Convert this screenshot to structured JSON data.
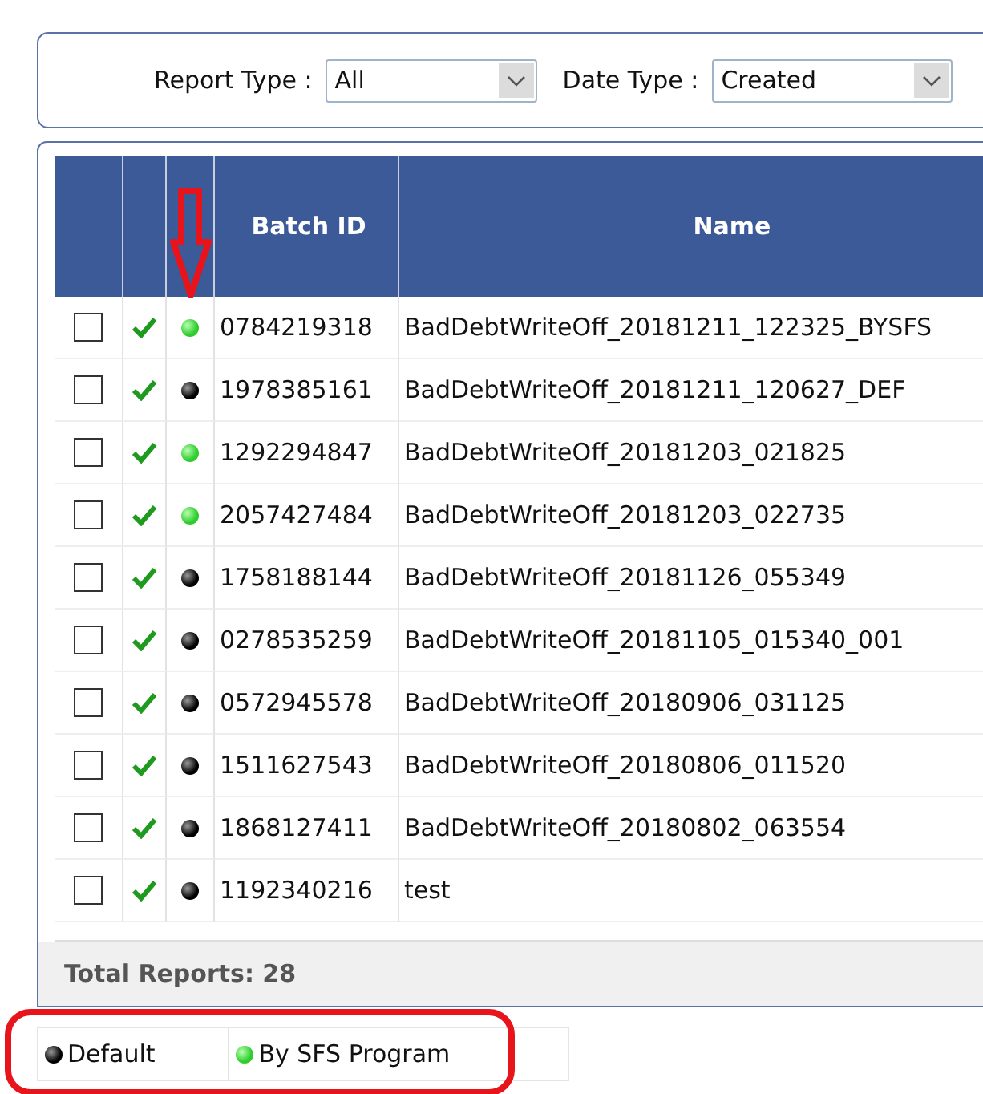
{
  "filters": [
    {
      "label": "Report Type :",
      "value": "All"
    },
    {
      "label": "Date Type :",
      "value": "Created"
    }
  ],
  "table": {
    "columns": [
      "Batch ID",
      "Name"
    ],
    "rows": [
      {
        "checked": false,
        "approved": true,
        "kind": "sfs",
        "batch_id": "0784219318",
        "name": "BadDebtWriteOff_20181211_122325_BYSFS"
      },
      {
        "checked": false,
        "approved": true,
        "kind": "default",
        "batch_id": "1978385161",
        "name": "BadDebtWriteOff_20181211_120627_DEF"
      },
      {
        "checked": false,
        "approved": true,
        "kind": "sfs",
        "batch_id": "1292294847",
        "name": "BadDebtWriteOff_20181203_021825"
      },
      {
        "checked": false,
        "approved": true,
        "kind": "sfs",
        "batch_id": "2057427484",
        "name": "BadDebtWriteOff_20181203_022735"
      },
      {
        "checked": false,
        "approved": true,
        "kind": "default",
        "batch_id": "1758188144",
        "name": "BadDebtWriteOff_20181126_055349"
      },
      {
        "checked": false,
        "approved": true,
        "kind": "default",
        "batch_id": "0278535259",
        "name": "BadDebtWriteOff_20181105_015340_001"
      },
      {
        "checked": false,
        "approved": true,
        "kind": "default",
        "batch_id": "0572945578",
        "name": "BadDebtWriteOff_20180906_031125"
      },
      {
        "checked": false,
        "approved": true,
        "kind": "default",
        "batch_id": "1511627543",
        "name": "BadDebtWriteOff_20180806_011520"
      },
      {
        "checked": false,
        "approved": true,
        "kind": "default",
        "batch_id": "1868127411",
        "name": "BadDebtWriteOff_20180802_063554"
      },
      {
        "checked": false,
        "approved": true,
        "kind": "default",
        "batch_id": "1192340216",
        "name": "test"
      }
    ],
    "total": "Total Reports: 28"
  },
  "legend": [
    {
      "kind": "default",
      "label": "Default"
    },
    {
      "kind": "sfs",
      "label": "By SFS Program"
    }
  ]
}
